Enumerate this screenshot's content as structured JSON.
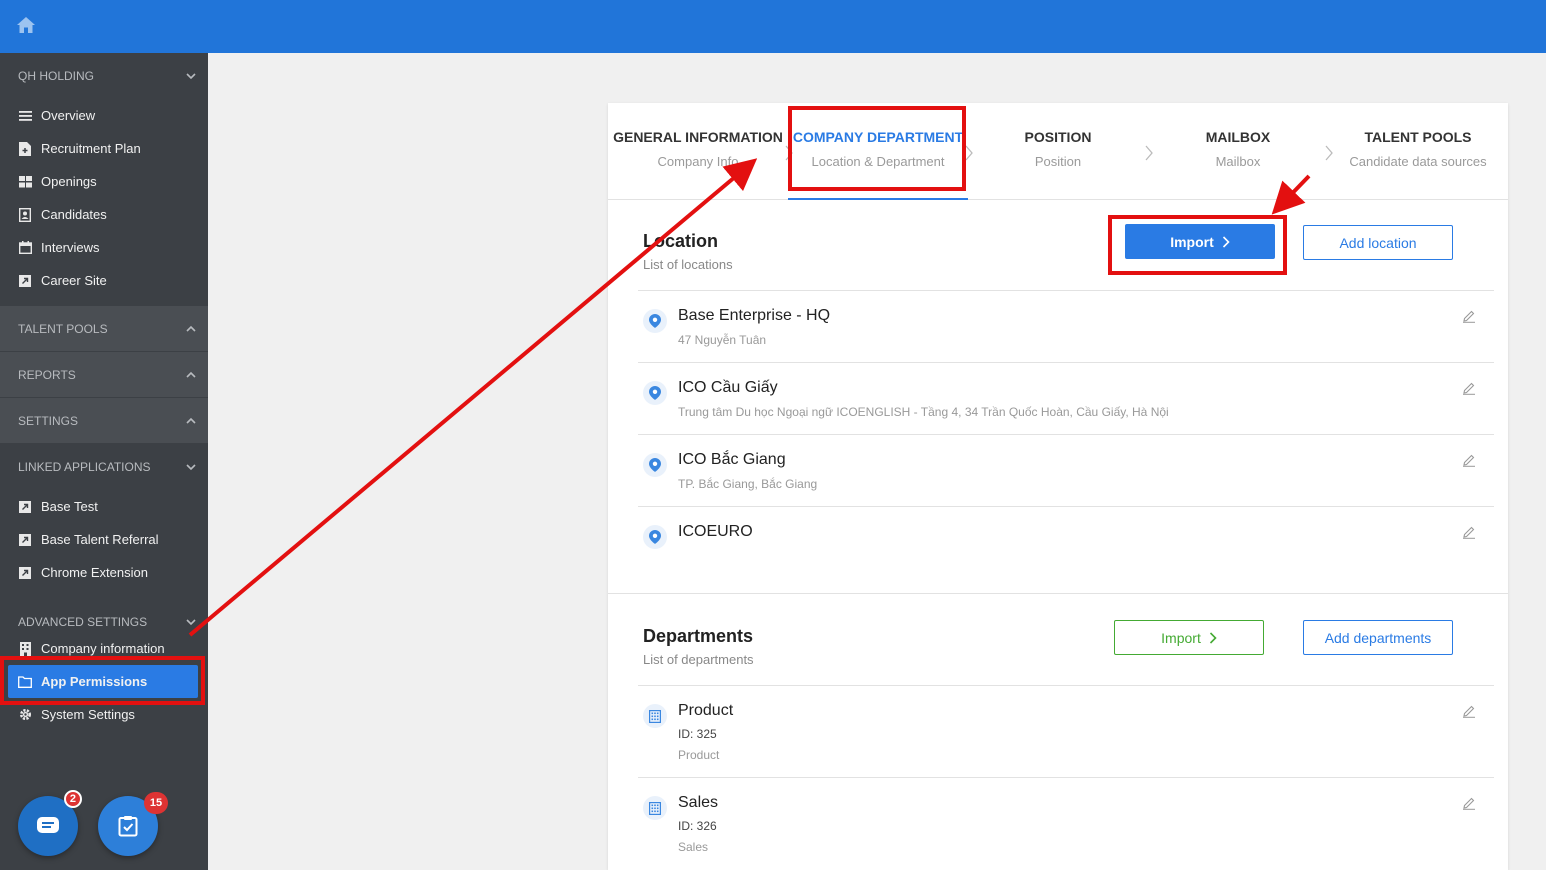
{
  "colors": {
    "primary": "#2175d9",
    "sidebar": "#3c4045",
    "accent": "#2a7be4",
    "success": "#44aa33",
    "annotation": "#e31010"
  },
  "topbar": {
    "icon": "home-icon"
  },
  "sidebar": {
    "org": "QH HOLDING",
    "main_items": [
      {
        "label": "Overview",
        "icon": "list-icon"
      },
      {
        "label": "Recruitment Plan",
        "icon": "doc-plus-icon"
      },
      {
        "label": "Openings",
        "icon": "grid-icon"
      },
      {
        "label": "Candidates",
        "icon": "contact-icon"
      },
      {
        "label": "Interviews",
        "icon": "calendar-icon"
      },
      {
        "label": "Career Site",
        "icon": "external-icon"
      }
    ],
    "talent_pools": "TALENT POOLS",
    "reports": "REPORTS",
    "settings": "SETTINGS",
    "linked_apps": "LINKED APPLICATIONS",
    "linked_items": [
      {
        "label": "Base Test",
        "icon": "external-icon"
      },
      {
        "label": "Base Talent Referral",
        "icon": "external-icon"
      },
      {
        "label": "Chrome Extension",
        "icon": "external-icon"
      }
    ],
    "advanced": "ADVANCED SETTINGS",
    "advanced_items": [
      {
        "label": "Company information",
        "icon": "building-icon"
      },
      {
        "label": "App Permissions",
        "icon": "folder-icon",
        "active": true
      },
      {
        "label": "System Settings",
        "icon": "gear-icon"
      }
    ],
    "chat_badge": "2",
    "task_badge": "15"
  },
  "steps": [
    {
      "title": "GENERAL INFORMATION",
      "sub": "Company Info"
    },
    {
      "title": "COMPANY DEPARTMENT",
      "sub": "Location & Department",
      "active": true
    },
    {
      "title": "POSITION",
      "sub": "Position"
    },
    {
      "title": "MAILBOX",
      "sub": "Mailbox"
    },
    {
      "title": "TALENT POOLS",
      "sub": "Candidate data sources"
    }
  ],
  "location": {
    "title": "Location",
    "subtitle": "List of locations",
    "import_label": "Import",
    "add_label": "Add location",
    "items": [
      {
        "name": "Base Enterprise - HQ",
        "address": "47 Nguyễn Tuân"
      },
      {
        "name": "ICO Cầu Giấy",
        "address": "Trung tâm Du học Ngoại ngữ ICOENGLISH - Tầng 4, 34 Trần Quốc Hoàn, Cầu Giấy, Hà Nội"
      },
      {
        "name": "ICO Bắc Giang",
        "address": "TP. Bắc Giang, Bắc Giang"
      },
      {
        "name": "ICOEURO",
        "address": ""
      }
    ]
  },
  "departments": {
    "title": "Departments",
    "subtitle": "List of departments",
    "import_label": "Import",
    "add_label": "Add departments",
    "items": [
      {
        "name": "Product",
        "id": "ID: 325",
        "desc": "Product"
      },
      {
        "name": "Sales",
        "id": "ID: 326",
        "desc": "Sales"
      }
    ]
  }
}
